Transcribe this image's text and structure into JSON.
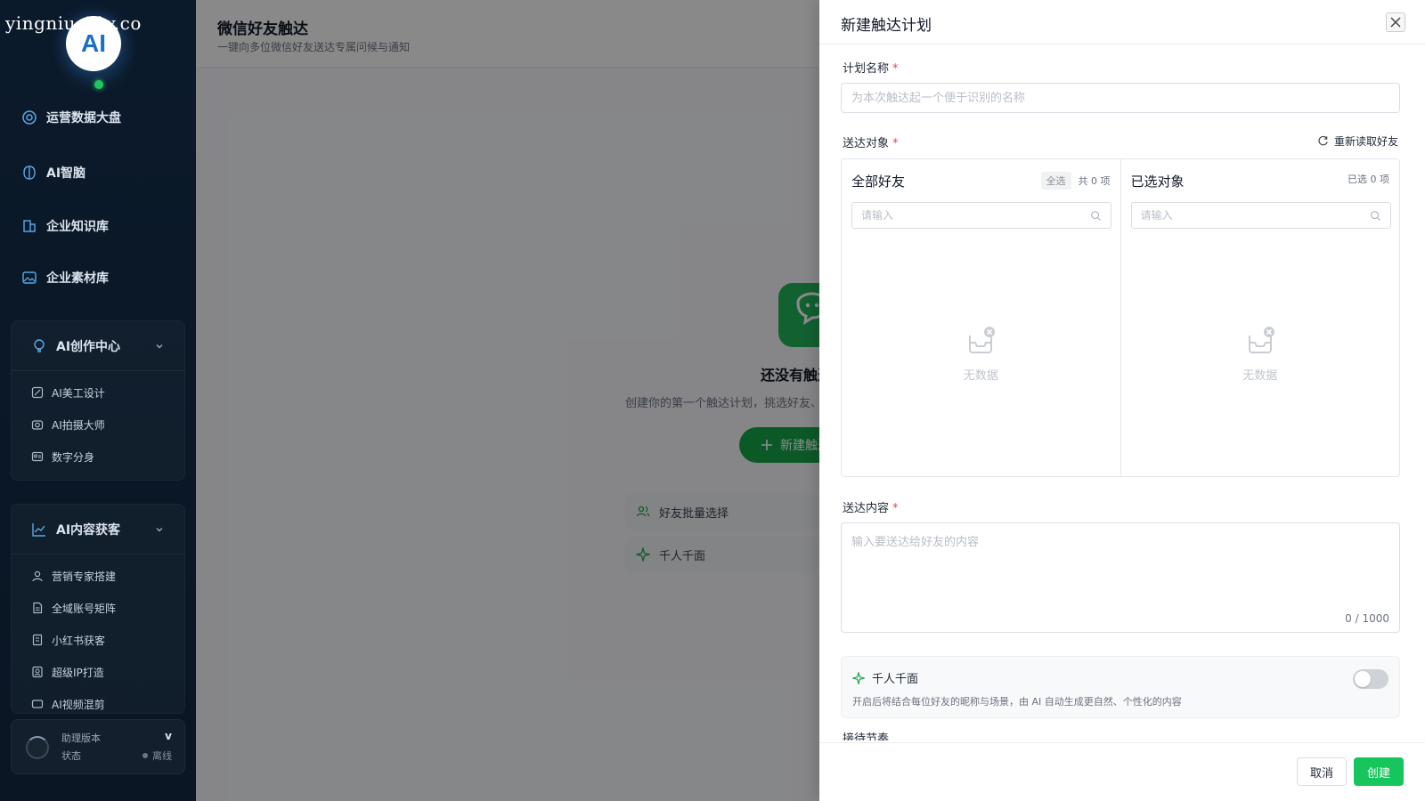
{
  "watermark": "yingniu.10v.co",
  "logo_text": "AI",
  "colors": {
    "accent": "#16c55b",
    "brand_blue": "#1d6fc4",
    "online": "#22c55e"
  },
  "sidebar": {
    "items": [
      {
        "label": "运营数据大盘",
        "icon": "dashboard-icon"
      },
      {
        "label": "AI智脑",
        "icon": "brain-icon"
      },
      {
        "label": "企业知识库",
        "icon": "knowledge-base-icon"
      },
      {
        "label": "企业素材库",
        "icon": "image-library-icon"
      }
    ],
    "groups": [
      {
        "label": "AI创作中心",
        "icon": "lightbulb-icon",
        "items": [
          {
            "label": "AI美工设计",
            "icon": "design-icon"
          },
          {
            "label": "AI拍摄大师",
            "icon": "camera-icon"
          },
          {
            "label": "数字分身",
            "icon": "avatar-card-icon"
          }
        ]
      },
      {
        "label": "AI内容获客",
        "icon": "chart-line-icon",
        "items": [
          {
            "label": "营销专家搭建",
            "icon": "user-icon"
          },
          {
            "label": "全域账号矩阵",
            "icon": "document-icon"
          },
          {
            "label": "小红书获客",
            "icon": "book-icon"
          },
          {
            "label": "超级IP打造",
            "icon": "badge-icon"
          },
          {
            "label": "AI视频混剪",
            "icon": "video-icon"
          }
        ]
      }
    ],
    "version": {
      "label": "助理版本",
      "value": "v",
      "status_label": "状态",
      "status_value": "离线"
    }
  },
  "main": {
    "title": "微信好友触达",
    "subtitle": "一键向多位微信好友送达专属问候与通知",
    "empty_title": "还没有触达计划",
    "empty_desc": "创建你的第一个触达计划，挑选好友、编写内容后即可一键送达",
    "new_button": "新建触达计划",
    "features": [
      "好友批量选择",
      "千人千面"
    ]
  },
  "drawer": {
    "title": "新建触达计划",
    "plan_name": {
      "label": "计划名称",
      "required": "*",
      "placeholder": "为本次触达起一个便于识别的名称",
      "value": ""
    },
    "target": {
      "label": "送达对象",
      "required": "*",
      "reload": "重新读取好友",
      "left": {
        "title": "全部好友",
        "select_all": "全选",
        "count": "共 0 项",
        "search_placeholder": "请输入",
        "empty": "无数据"
      },
      "right": {
        "title": "已选对象",
        "count": "已选 0 项",
        "search_placeholder": "请输入",
        "empty": "无数据"
      }
    },
    "content": {
      "label": "送达内容",
      "required": "*",
      "placeholder": "输入要送达给好友的内容",
      "counter": "0 / 1000"
    },
    "persona": {
      "title": "千人千面",
      "desc": "开启后将结合每位好友的昵称与场景，由 AI 自动生成更自然、个性化的内容",
      "enabled": false
    },
    "next_label": "接待节奏",
    "cancel": "取消",
    "create": "创建"
  }
}
